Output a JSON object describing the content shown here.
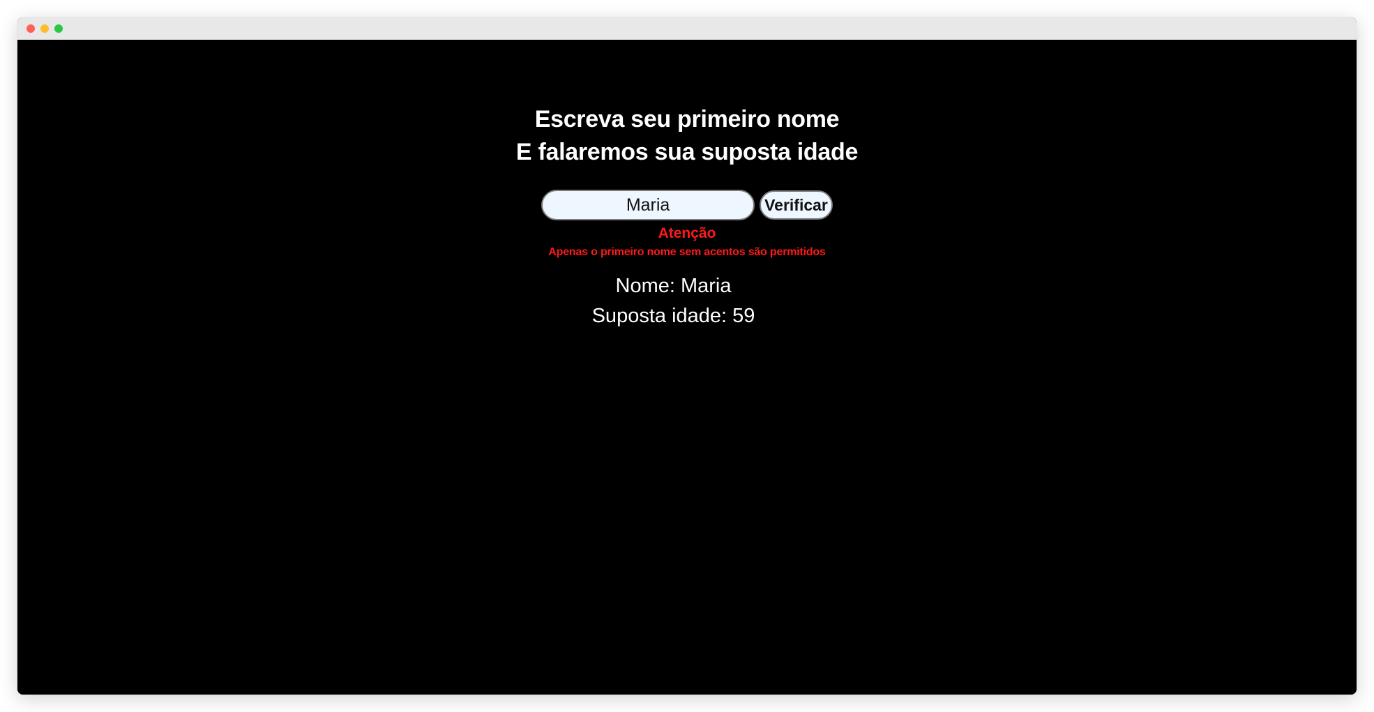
{
  "window": {
    "controls": {
      "close_color": "#ff5f57",
      "minimize_color": "#febc2e",
      "maximize_color": "#28c840"
    }
  },
  "page": {
    "heading_line1": "Escreva seu primeiro nome",
    "heading_line2": "E falaremos sua suposta idade",
    "form": {
      "name_value": "Maria",
      "button_label": "Verificar"
    },
    "warning": {
      "title": "Atenção",
      "text": "Apenas o primeiro nome sem acentos são permitidos",
      "color": "#ff1a1a"
    },
    "result": {
      "name_line": "Nome: Maria",
      "age_line": "Suposta idade: 59"
    }
  }
}
